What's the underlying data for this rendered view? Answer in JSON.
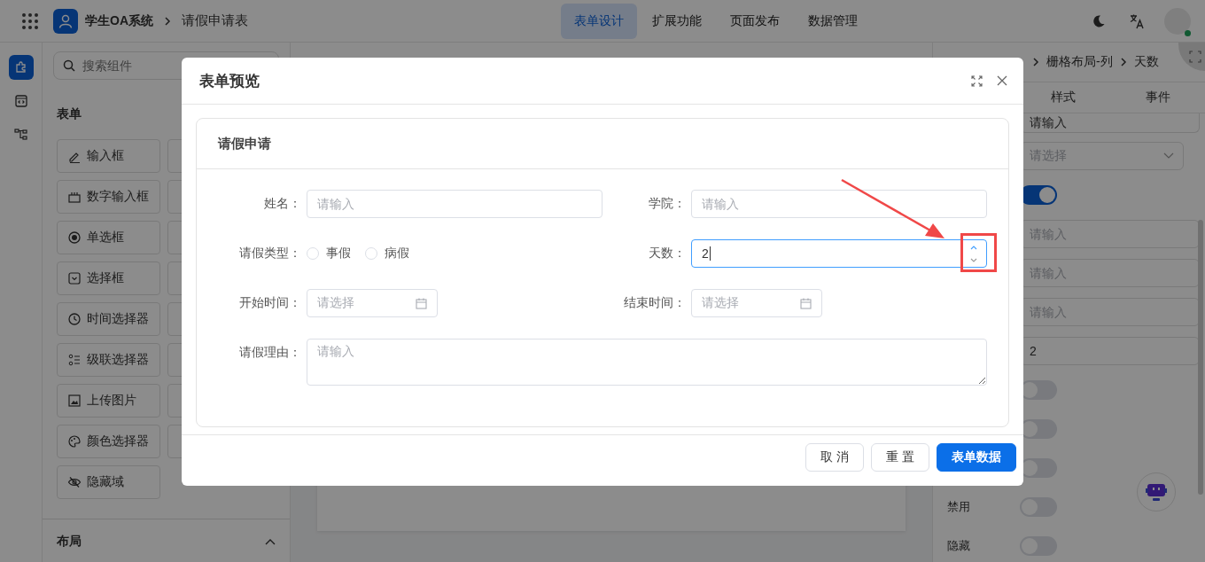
{
  "header": {
    "app_name": "学生OA系统",
    "page_title": "请假申请表",
    "nav": [
      {
        "label": "表单设计",
        "selected": true
      },
      {
        "label": "扩展功能",
        "selected": false
      },
      {
        "label": "页面发布",
        "selected": false
      },
      {
        "label": "数据管理",
        "selected": false
      }
    ]
  },
  "rail": [
    {
      "selected": true
    },
    {
      "selected": false
    },
    {
      "selected": false
    }
  ],
  "components_panel": {
    "search_placeholder": "搜索组件",
    "section_title": "表单",
    "items": [
      {
        "label": "输入框"
      },
      {
        "label": "数字输入框"
      },
      {
        "label": "单选框"
      },
      {
        "label": "选择框"
      },
      {
        "label": "时间选择器"
      },
      {
        "label": "级联选择器"
      },
      {
        "label": "上传图片"
      },
      {
        "label": "颜色选择器"
      },
      {
        "label": "隐藏域"
      }
    ],
    "layout_section_title": "布局"
  },
  "properties_panel": {
    "breadcrumb": [
      "栅格布局-列",
      "天数"
    ],
    "tabs": [
      {
        "label": "样式",
        "selected": false
      },
      {
        "label": "事件",
        "selected": false
      }
    ],
    "rows": [
      {
        "kind": "input",
        "value": "请输入"
      },
      {
        "kind": "select",
        "placeholder": "请选择"
      },
      {
        "kind": "switch",
        "on": true
      },
      {
        "kind": "input",
        "placeholder": "请输入"
      },
      {
        "kind": "input",
        "placeholder": "请输入"
      },
      {
        "kind": "input",
        "placeholder": "请输入"
      },
      {
        "kind": "input",
        "value": "2"
      },
      {
        "kind": "switch",
        "on": false
      },
      {
        "kind": "switch",
        "on": false
      },
      {
        "kind": "switch",
        "on": false
      },
      {
        "kind": "switch",
        "label": "禁用",
        "on": false
      },
      {
        "kind": "switch",
        "label": "隐藏",
        "on": false
      }
    ]
  },
  "modal": {
    "title": "表单预览",
    "card_title": "请假申请",
    "fields": [
      {
        "kind": "text",
        "label": "姓名：",
        "placeholder": "请输入"
      },
      {
        "kind": "text",
        "label": "学院：",
        "placeholder": "请输入"
      },
      {
        "kind": "radio",
        "label": "请假类型：",
        "options": [
          {
            "label": "事假",
            "selected": false
          },
          {
            "label": "病假",
            "selected": false
          }
        ]
      },
      {
        "kind": "number",
        "label": "天数：",
        "value": "2",
        "focused": true
      },
      {
        "kind": "date",
        "label": "开始时间：",
        "placeholder": "请选择"
      },
      {
        "kind": "date",
        "label": "结束时间：",
        "placeholder": "请选择"
      },
      {
        "kind": "textarea",
        "label": "请假理由：",
        "placeholder": "请输入"
      }
    ],
    "buttons": [
      {
        "label": "取 消",
        "kind": "default"
      },
      {
        "label": "重 置",
        "kind": "default"
      },
      {
        "label": "表单数据",
        "kind": "primary"
      }
    ]
  }
}
